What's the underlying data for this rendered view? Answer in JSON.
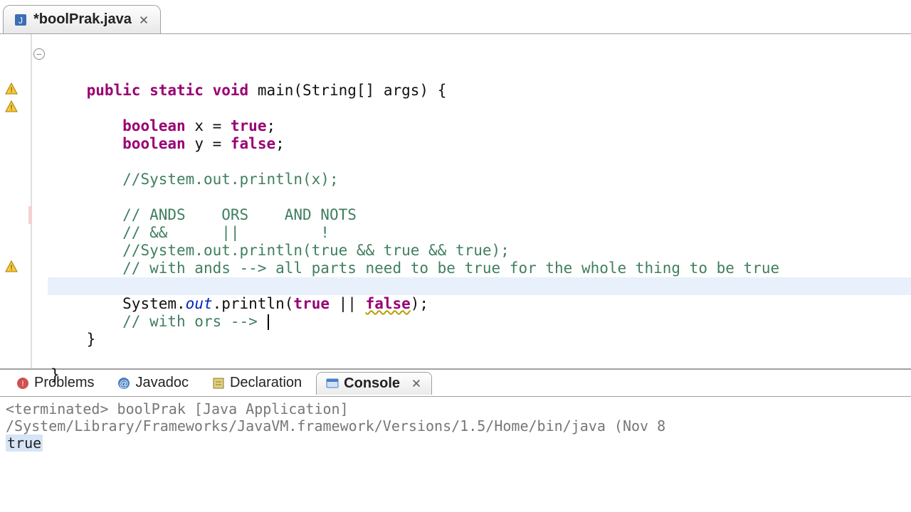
{
  "tab": {
    "title": "*boolPrak.java"
  },
  "code": {
    "l1a": "public",
    "l1b": "static",
    "l1c": "void",
    "l1d": " main(String[] args) {",
    "l3a": "boolean",
    "l3b": " x = ",
    "l3c": "true",
    "l3d": ";",
    "l4a": "boolean",
    "l4b": " y = ",
    "l4c": "false",
    "l4d": ";",
    "l6": "//System.out.println(x);",
    "l8": "// ANDS    ORS    AND NOTS",
    "l9": "// &&      ||         !",
    "l10": "//System.out.println(true && true && true);",
    "l11": "// with ands --> all parts need to be true for the whole thing to be true",
    "l13a": "System.",
    "l13b": "out",
    "l13c": ".println(",
    "l13d": "true",
    "l13e": " || ",
    "l13f": "false",
    "l13g": ");",
    "l14": "// with ors --> ",
    "l15": "}",
    "l17": "}"
  },
  "views": {
    "problems": "Problems",
    "javadoc": "Javadoc",
    "declaration": "Declaration",
    "console": "Console"
  },
  "console": {
    "status": "<terminated> boolPrak [Java Application] /System/Library/Frameworks/JavaVM.framework/Versions/1.5/Home/bin/java (Nov 8",
    "output": "true"
  }
}
